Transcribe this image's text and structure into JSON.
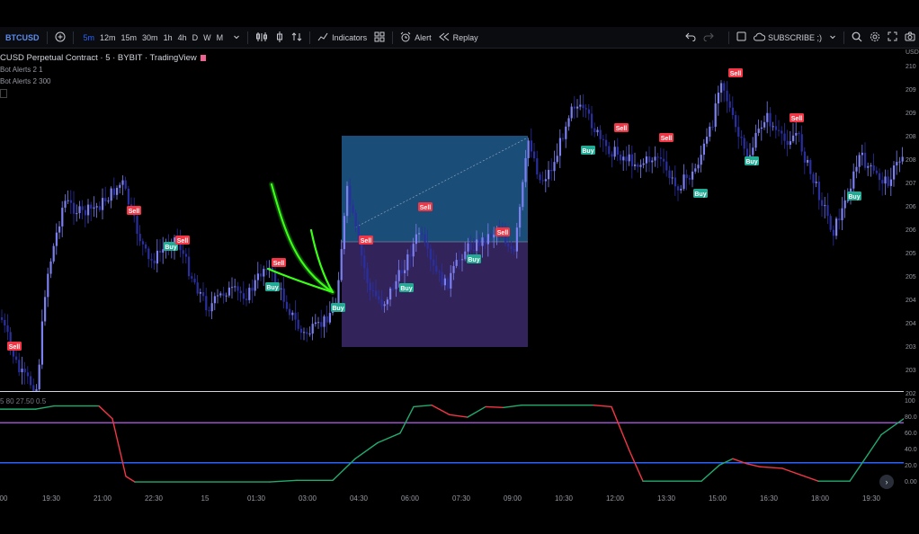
{
  "toolbar": {
    "symbol": "BTCUSD",
    "add_symbol_icon": "plus-circle-icon",
    "timeframes": [
      "5m",
      "12m",
      "15m",
      "30m",
      "1h",
      "4h",
      "D",
      "W",
      "M"
    ],
    "active_timeframe": "5m",
    "indicators_label": "Indicators",
    "alert_label": "Alert",
    "replay_label": "Replay",
    "subscribe_label": "SUBSCRIBE ;)"
  },
  "legend": {
    "title": "CUSD Perpetual Contract · 5 · BYBIT · TradingView",
    "indicator1_name": "Bot Alerts",
    "indicator1_val": "2 1",
    "indicator2_name": "Bot Alerts",
    "indicator2_val": "2 300"
  },
  "oscillator": {
    "legend": "5 80 27.50 0.5",
    "upper_level": 75,
    "lower_level": 25,
    "upper_color": "#9c4dcc",
    "lower_color": "#2962ff"
  },
  "price_axis": {
    "currency": "USD",
    "ticks": [
      "210",
      "209",
      "209",
      "208",
      "208",
      "207",
      "206",
      "206",
      "205",
      "205",
      "204",
      "204",
      "203",
      "203",
      "202"
    ]
  },
  "osc_axis": {
    "ticks": [
      "100",
      "80.0",
      "60.0",
      "40.0",
      "20.0",
      "0.00"
    ]
  },
  "time_axis": {
    "ticks": [
      "00",
      "19:30",
      "21:00",
      "22:30",
      "15",
      "01:30",
      "03:00",
      "04:30",
      "06:00",
      "07:30",
      "09:00",
      "10:30",
      "12:00",
      "13:30",
      "15:00",
      "16:30",
      "18:00",
      "19:30"
    ]
  },
  "signals": {
    "sell_label": "Sell",
    "buy_label": "Buy",
    "sell_color": "#f23645",
    "buy_color": "#22ab94"
  },
  "position_box": {
    "profit_color": "#1e5a8c",
    "loss_color": "#3b2a6b"
  },
  "colors": {
    "candle_up": "#7b7ff0",
    "candle_down": "#2a2fa0",
    "arrow": "#39ff14"
  }
}
